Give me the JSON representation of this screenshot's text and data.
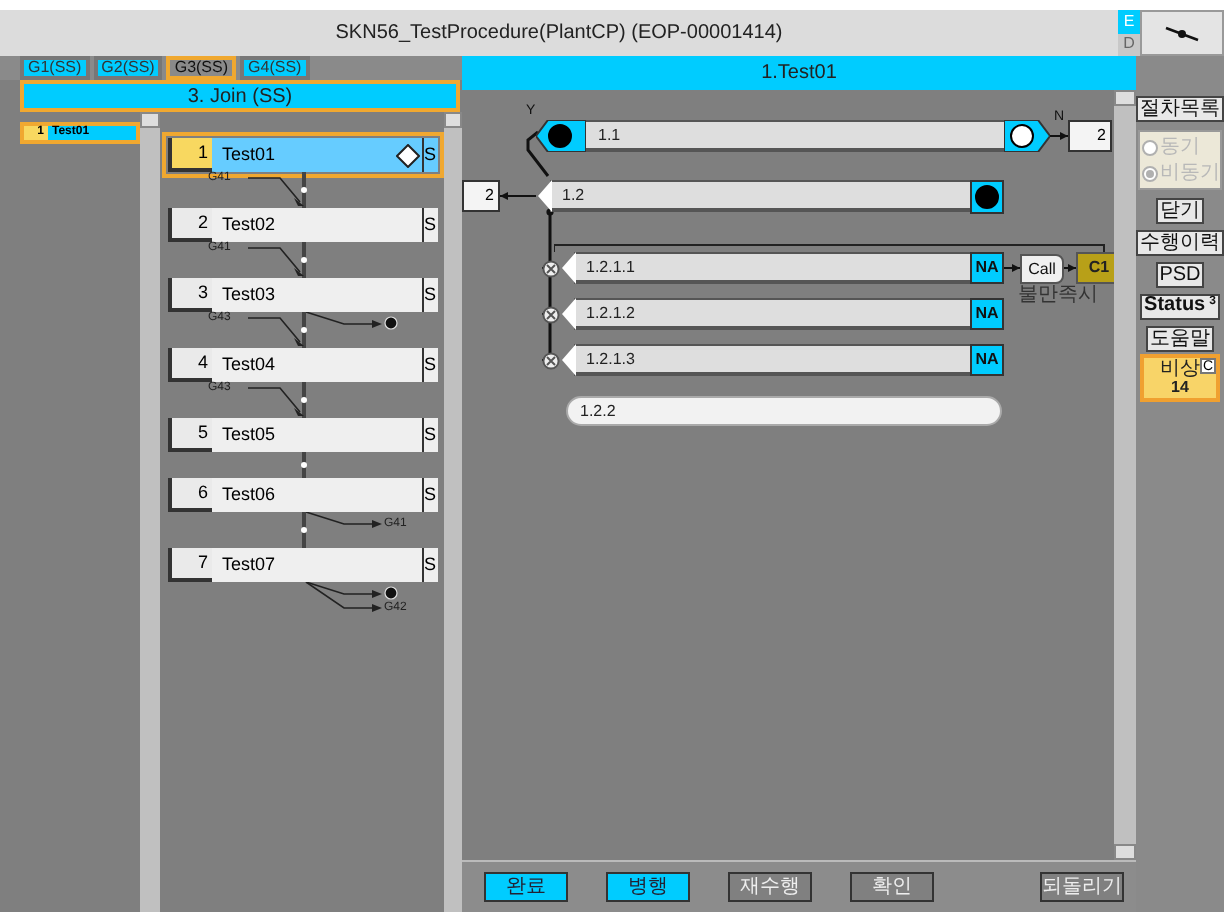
{
  "window": {
    "title": "SKN56_TestProcedure(PlantCP) (EOP-00001414)"
  },
  "mode_switch": [
    {
      "label": "E",
      "selected": true
    },
    {
      "label": "D",
      "selected": false
    }
  ],
  "tabs": [
    {
      "label": "G1(SS)",
      "selected": false
    },
    {
      "label": "G2(SS)",
      "selected": false
    },
    {
      "label": "G3(SS)",
      "selected": true
    },
    {
      "label": "G4(SS)",
      "selected": false
    }
  ],
  "procedure": {
    "title": "3. Join (SS)"
  },
  "step_index": [
    {
      "number": "1",
      "name": "Test01",
      "selected": true
    }
  ],
  "steps": [
    {
      "number": "1",
      "name": "Test01",
      "type": "S",
      "selected": true,
      "diamond": true
    },
    {
      "number": "2",
      "name": "Test02",
      "type": "S",
      "selected": false,
      "diamond": false,
      "input": "G41"
    },
    {
      "number": "3",
      "name": "Test03",
      "type": "S",
      "selected": false,
      "diamond": false,
      "input": "G41",
      "outputs": [
        {
          "kind": "dot"
        }
      ]
    },
    {
      "number": "4",
      "name": "Test04",
      "type": "S",
      "selected": false,
      "diamond": false,
      "input": "G43"
    },
    {
      "number": "5",
      "name": "Test05",
      "type": "S",
      "selected": false,
      "diamond": false,
      "input": "G43"
    },
    {
      "number": "6",
      "name": "Test06",
      "type": "S",
      "selected": false,
      "diamond": false,
      "outputs": [
        {
          "kind": "label",
          "text": "G41"
        }
      ]
    },
    {
      "number": "7",
      "name": "Test07",
      "type": "S",
      "selected": false,
      "diamond": false,
      "outputs": [
        {
          "kind": "dot"
        },
        {
          "kind": "label",
          "text": "G42"
        }
      ]
    }
  ],
  "current_step": {
    "title": "1.Test01"
  },
  "flow": [
    {
      "kind": "decision",
      "label": "1.1",
      "yes_label": "Y",
      "no_label": "N",
      "no_target": "2",
      "yes_marked": true,
      "no_marked": false
    },
    {
      "kind": "action",
      "label": "1.2",
      "target": "2",
      "marked": true
    },
    {
      "kind": "check",
      "label": "1.2.1.1",
      "status": "NA",
      "call": "Call",
      "call_target": "C1",
      "call_caption": "불만족시"
    },
    {
      "kind": "check",
      "label": "1.2.1.2",
      "status": "NA"
    },
    {
      "kind": "check",
      "label": "1.2.1.3",
      "status": "NA"
    },
    {
      "kind": "note",
      "label": "1.2.2"
    }
  ],
  "side_panel": {
    "procedure_list": "절차목록",
    "sync_options": [
      {
        "label": "동기",
        "selected": false
      },
      {
        "label": "비동기",
        "selected": true
      }
    ],
    "sync_disabled": true,
    "buttons": [
      {
        "label": "닫기"
      },
      {
        "label": "수행이력"
      },
      {
        "label": "PSD"
      },
      {
        "label": "Status",
        "badge": "3"
      },
      {
        "label": "도움말"
      }
    ],
    "alarm": {
      "label": "비상",
      "count": "14",
      "badge": "C"
    }
  },
  "actions": [
    {
      "label": "완료",
      "highlighted": true
    },
    {
      "label": "병행",
      "highlighted": true
    },
    {
      "label": "재수행",
      "highlighted": false
    },
    {
      "label": "확인",
      "highlighted": false
    },
    {
      "label": "되돌리기",
      "highlighted": false
    }
  ]
}
